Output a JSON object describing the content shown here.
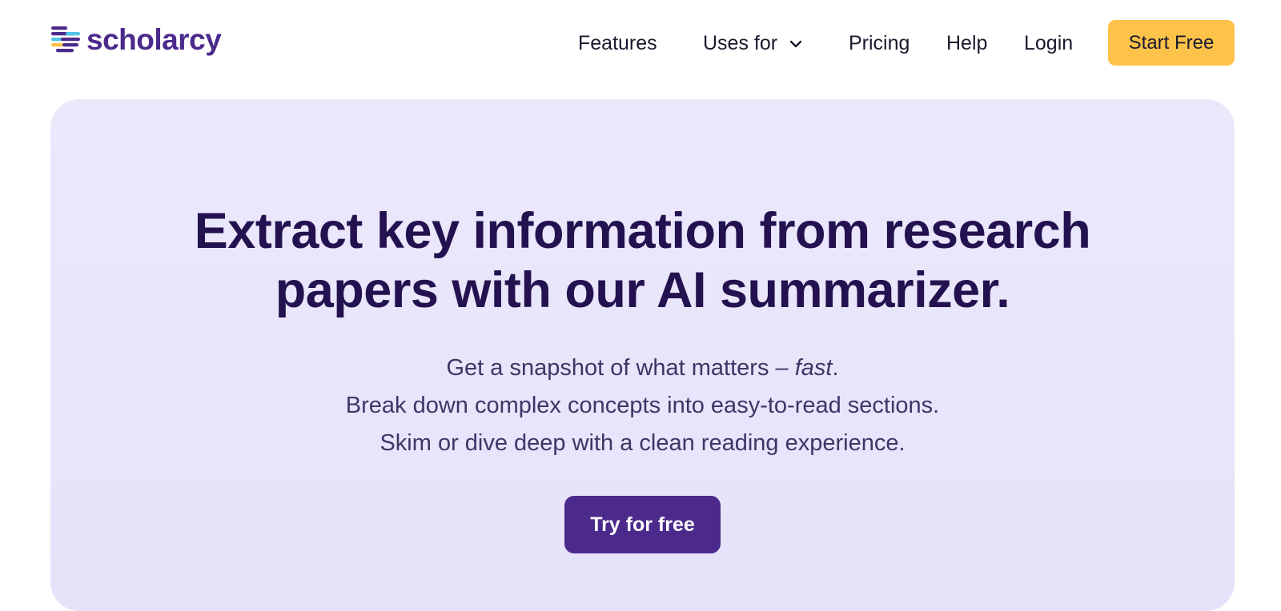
{
  "header": {
    "logo_text": "scholarcy",
    "nav": {
      "features": "Features",
      "uses_for": "Uses for",
      "pricing": "Pricing",
      "help": "Help",
      "login": "Login"
    },
    "cta_label": "Start Free"
  },
  "hero": {
    "title_line1": "Extract key information from research",
    "title_line2": "papers with our AI summarizer.",
    "sub_line1_prefix": "Get a snapshot of what matters – ",
    "sub_line1_emphasis": "fast",
    "sub_line1_suffix": ".",
    "sub_line2": "Break down complex concepts into easy-to-read sections.",
    "sub_line3": "Skim or dive deep with a clean reading experience.",
    "button_label": "Try for free"
  },
  "colors": {
    "brand_purple": "#4b2a8c",
    "cta_yellow": "#fdc24a",
    "hero_background": "#ebe8fc",
    "title_text": "#23124f"
  },
  "icons": {
    "logo": "scholarcy-logo-icon",
    "dropdown": "chevron-down-icon"
  }
}
